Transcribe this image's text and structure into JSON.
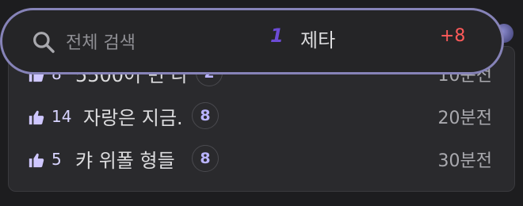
{
  "search": {
    "placeholder": "전체 검색",
    "rank": "1",
    "keyword": "제타",
    "change": "+8"
  },
  "posts": [
    {
      "likes": "8",
      "title": "5500어 번 다",
      "comments": "2",
      "time": "10분전"
    },
    {
      "likes": "14",
      "title": "자랑은 지금.",
      "comments": "8",
      "time": "20분전"
    },
    {
      "likes": "5",
      "title": "캬 위폴 형들",
      "comments": "8",
      "time": "30분전"
    }
  ],
  "colors": {
    "accent": "#8683b8",
    "rank_number": "#6c4bd6",
    "rank_change": "#ff5a5a",
    "like_icon": "#cfc7ff"
  },
  "icons": {
    "search": "search-icon",
    "like": "thumbs-up-icon"
  }
}
